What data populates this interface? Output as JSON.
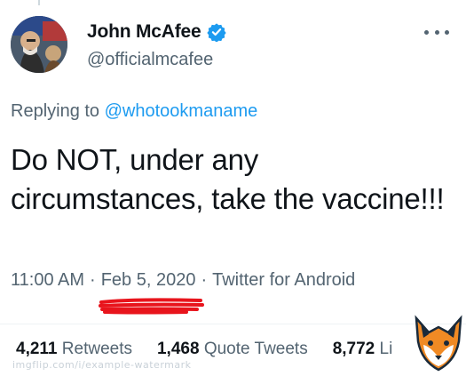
{
  "tweet": {
    "display_name": "John McAfee",
    "handle": "@officialmcafee",
    "replying_prefix": "Replying to",
    "replying_mention": "@whotookmaname",
    "text": "Do NOT, under any circumstances, take the vaccine!!!",
    "time": "11:00 AM",
    "date": "Feb 5, 2020",
    "source": "Twitter for Android",
    "separator": "·"
  },
  "stats": [
    {
      "count": "4,211",
      "label": "Retweets"
    },
    {
      "count": "1,468",
      "label": "Quote Tweets"
    },
    {
      "count": "8,772",
      "label": "Li"
    }
  ],
  "watermark": {
    "text": "imgflip.com/i/example-watermark"
  },
  "colors": {
    "verified": "#1d9bf0",
    "mention": "#1d9bf0",
    "secondary_text": "#536471",
    "primary_text": "#0f1419",
    "scribble": "#e8141c"
  },
  "icons": {
    "verified": "verified-badge-icon",
    "more": "more-options-icon",
    "watermark": "fox-logo"
  }
}
